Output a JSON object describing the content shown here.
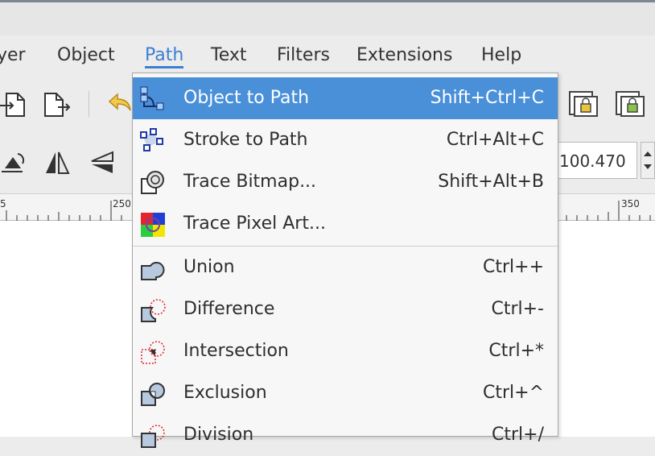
{
  "menubar": {
    "items": [
      "yer",
      "Object",
      "Path",
      "Text",
      "Filters",
      "Extensions",
      "Help"
    ],
    "active": "Path"
  },
  "ruler": {
    "labels": [
      "5",
      "250",
      "350"
    ]
  },
  "toolbar": {
    "zoom_value": "100.470"
  },
  "path_menu": {
    "items": [
      {
        "label": "Object to Path",
        "shortcut": "Shift+Ctrl+C",
        "icon": "object-to-path-icon",
        "highlighted": true
      },
      {
        "label": "Stroke to Path",
        "shortcut": "Ctrl+Alt+C",
        "icon": "stroke-to-path-icon"
      },
      {
        "label": "Trace Bitmap...",
        "shortcut": "Shift+Alt+B",
        "icon": "trace-bitmap-icon"
      },
      {
        "label": "Trace Pixel Art...",
        "shortcut": "",
        "icon": "trace-pixel-art-icon"
      },
      {
        "label": "Union",
        "shortcut": "Ctrl++",
        "icon": "union-icon"
      },
      {
        "label": "Difference",
        "shortcut": "Ctrl+-",
        "icon": "difference-icon"
      },
      {
        "label": "Intersection",
        "shortcut": "Ctrl+*",
        "icon": "intersection-icon"
      },
      {
        "label": "Exclusion",
        "shortcut": "Ctrl+^",
        "icon": "exclusion-icon"
      },
      {
        "label": "Division",
        "shortcut": "Ctrl+/",
        "icon": "division-icon"
      }
    ]
  },
  "colors": {
    "highlight": "#4a90d9",
    "accent": "#3b7fd1"
  }
}
